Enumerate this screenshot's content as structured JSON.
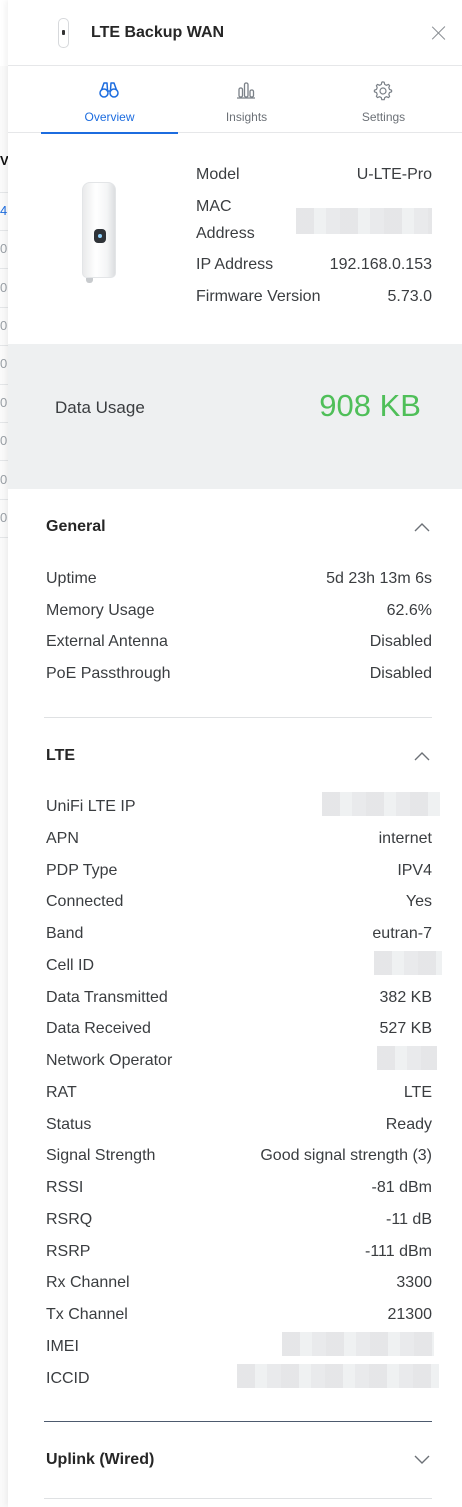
{
  "header": {
    "title": "LTE Backup WAN"
  },
  "tabs": [
    {
      "label": "Overview",
      "icon": "binoculars-icon",
      "active": true
    },
    {
      "label": "Insights",
      "icon": "bar-chart-icon",
      "active": false
    },
    {
      "label": "Settings",
      "icon": "gear-icon",
      "active": false
    }
  ],
  "device": {
    "model_label": "Model",
    "model_value": "U-LTE-Pro",
    "mac_label": "MAC Address",
    "mac_label_line1": "MAC",
    "mac_label_line2": "Address",
    "ip_label": "IP Address",
    "ip_value": "192.168.0.153",
    "fw_label": "Firmware Version",
    "fw_value": "5.73.0"
  },
  "usage": {
    "label": "Data Usage",
    "value": "908 KB",
    "color": "#4fbf59"
  },
  "general": {
    "title": "General",
    "rows": [
      {
        "k": "Uptime",
        "v": "5d 23h 13m 6s"
      },
      {
        "k": "Memory Usage",
        "v": "62.6%"
      },
      {
        "k": "External Antenna",
        "v": "Disabled"
      },
      {
        "k": "PoE Passthrough",
        "v": "Disabled"
      }
    ]
  },
  "lte": {
    "title": "LTE",
    "rows": [
      {
        "k": "UniFi LTE IP",
        "v": ""
      },
      {
        "k": "APN",
        "v": "internet"
      },
      {
        "k": "PDP Type",
        "v": "IPV4"
      },
      {
        "k": "Connected",
        "v": "Yes"
      },
      {
        "k": "Band",
        "v": "eutran-7"
      },
      {
        "k": "Cell ID",
        "v": ""
      },
      {
        "k": "Data Transmitted",
        "v": "382 KB"
      },
      {
        "k": "Data Received",
        "v": "527 KB"
      },
      {
        "k": "Network Operator",
        "v": ""
      },
      {
        "k": "RAT",
        "v": "LTE"
      },
      {
        "k": "Status",
        "v": "Ready"
      },
      {
        "k": "Signal Strength",
        "v": "Good signal strength (3)"
      },
      {
        "k": "RSSI",
        "v": "-81 dBm"
      },
      {
        "k": "RSRQ",
        "v": "-11 dB"
      },
      {
        "k": "RSRP",
        "v": "-111 dBm"
      },
      {
        "k": "Rx Channel",
        "v": "3300"
      },
      {
        "k": "Tx Channel",
        "v": "21300"
      },
      {
        "k": "IMEI",
        "v": ""
      },
      {
        "k": "ICCID",
        "v": ""
      }
    ]
  },
  "uplink": {
    "title": "Uplink (Wired)"
  },
  "background_table": {
    "header_glyph": "V",
    "highlight_glyph": "4",
    "cell_glyph": "0"
  },
  "colors": {
    "accent": "#1c6cdf",
    "usage_green": "#4fbf59"
  }
}
